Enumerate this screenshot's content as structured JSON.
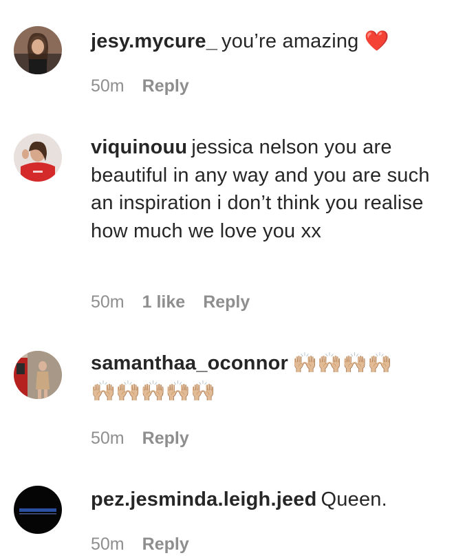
{
  "comments": [
    {
      "username": "jesy.mycure_",
      "text": "you’re amazing",
      "emoji": "❤️",
      "time": "50m",
      "likes": "",
      "reply": "Reply"
    },
    {
      "username": "viquinouu",
      "text": "jessica nelson you are beautiful in any way and you are such an inspiration i don’t think you realise how much we love you xx",
      "time": "50m",
      "likes": "1 like",
      "reply": "Reply"
    },
    {
      "username": "samanthaa_oconnor",
      "emoji_line1": "🙌🏼🙌🏼🙌🏼🙌🏼",
      "emoji_line2": "🙌🏼🙌🏼🙌🏼🙌🏼🙌🏼",
      "time": "50m",
      "likes": "",
      "reply": "Reply"
    },
    {
      "username": "pez.jesminda.leigh.jeed",
      "text": "Queen.",
      "time": "50m",
      "likes": "",
      "reply": "Reply"
    }
  ]
}
